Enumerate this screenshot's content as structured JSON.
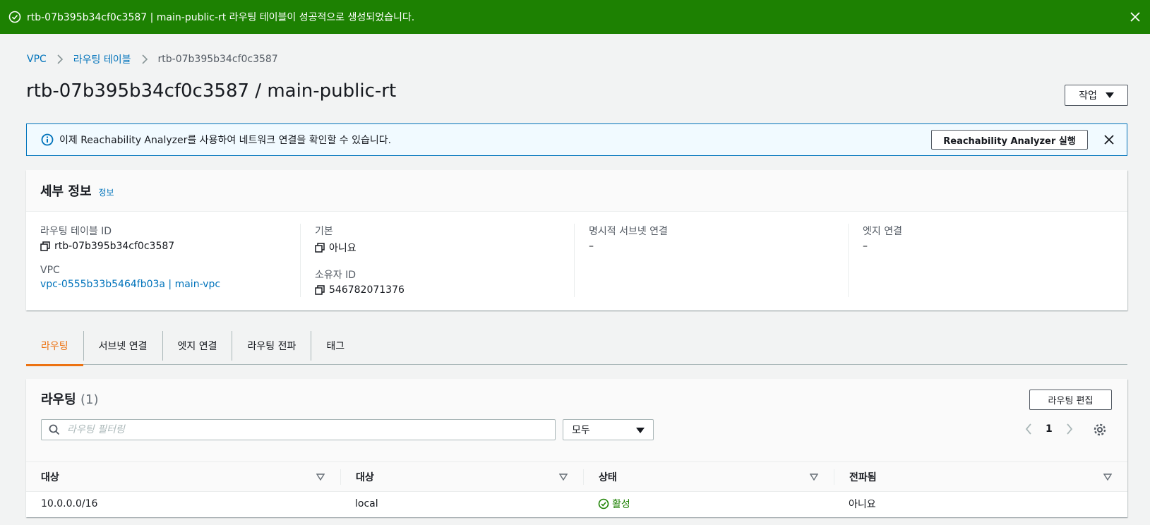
{
  "flash": {
    "message": "rtb-07b395b34cf0c3587 | main-public-rt 라우팅 테이블이 성공적으로 생성되었습니다.",
    "color": "#1d8102"
  },
  "breadcrumb": {
    "items": [
      "VPC",
      "라우팅 테이블"
    ],
    "current": "rtb-07b395b34cf0c3587"
  },
  "page": {
    "title": "rtb-07b395b34cf0c3587 / main-public-rt",
    "actions_label": "작업"
  },
  "info_banner": {
    "text": "이제 Reachability Analyzer를 사용하여 네트워크 연결을 확인할 수 있습니다.",
    "button_label": "Reachability Analyzer 실행"
  },
  "details": {
    "title": "세부 정보",
    "info_link": "정보",
    "route_table_id_label": "라우팅 테이블 ID",
    "route_table_id": "rtb-07b395b34cf0c3587",
    "vpc_label": "VPC",
    "vpc_value": "vpc-0555b33b5464fb03a | main-vpc",
    "main_label": "기본",
    "main_value": "아니요",
    "owner_label": "소유자 ID",
    "owner_value": "546782071376",
    "explicit_subnet_label": "명시적 서브넷 연결",
    "explicit_subnet_value": "–",
    "edge_label": "엣지 연결",
    "edge_value": "–"
  },
  "tabs": [
    {
      "label": "라우팅",
      "active": true
    },
    {
      "label": "서브넷 연결",
      "active": false
    },
    {
      "label": "엣지 연결",
      "active": false
    },
    {
      "label": "라우팅 전파",
      "active": false
    },
    {
      "label": "태그",
      "active": false
    }
  ],
  "routes": {
    "title": "라우팅",
    "count": "(1)",
    "edit_label": "라우팅 편집",
    "filter_placeholder": "라우팅 필터링",
    "select_value": "모두",
    "page": "1",
    "columns": [
      "대상",
      "대상",
      "상태",
      "전파됨"
    ],
    "rows": [
      {
        "destination": "10.0.0.0/16",
        "target": "local",
        "status": "활성",
        "propagated": "아니요"
      }
    ]
  },
  "colors": {
    "accent": "#ec7211",
    "link": "#0073bb",
    "success": "#1d8102"
  }
}
